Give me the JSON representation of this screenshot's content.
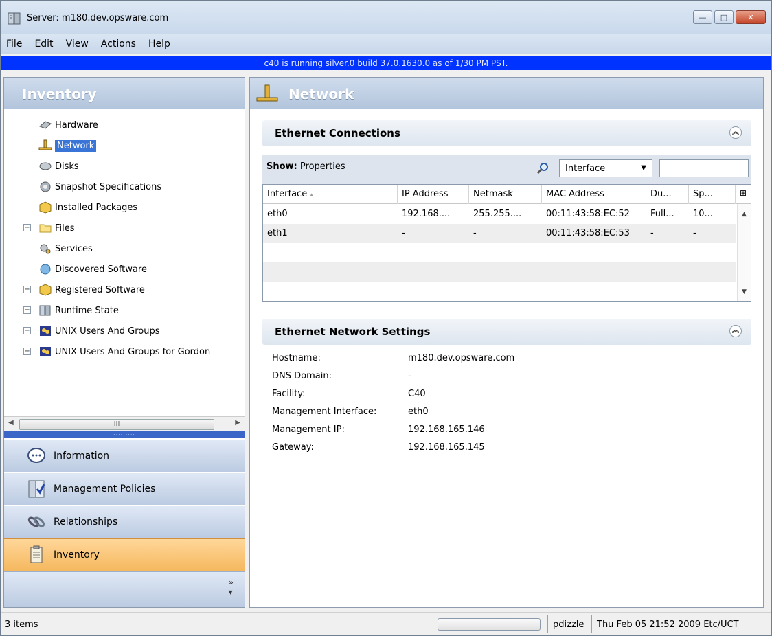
{
  "window": {
    "title": "Server: m180.dev.opsware.com",
    "minimize": "—",
    "maximize": "□",
    "close": "✕"
  },
  "menu": [
    "File",
    "Edit",
    "View",
    "Actions",
    "Help"
  ],
  "banner": "c40 is running silver.0 build 37.0.1630.0 as of 1/30 PM PST.",
  "left": {
    "header": "Inventory",
    "tree": [
      {
        "label": "Hardware",
        "icon": "hardware-icon"
      },
      {
        "label": "Network",
        "icon": "network-icon",
        "selected": true
      },
      {
        "label": "Disks",
        "icon": "disk-icon"
      },
      {
        "label": "Snapshot Specifications",
        "icon": "snapshot-icon"
      },
      {
        "label": "Installed Packages",
        "icon": "package-icon"
      },
      {
        "label": "Files",
        "icon": "folder-icon",
        "expandable": true
      },
      {
        "label": "Services",
        "icon": "services-icon"
      },
      {
        "label": "Discovered Software",
        "icon": "discovered-software-icon"
      },
      {
        "label": "Registered Software",
        "icon": "registered-software-icon",
        "expandable": true
      },
      {
        "label": "Runtime State",
        "icon": "server-icon",
        "expandable": true
      },
      {
        "label": "UNIX Users And Groups",
        "icon": "users-icon",
        "expandable": true
      },
      {
        "label": "UNIX Users And Groups for Gordon",
        "icon": "users-icon",
        "expandable": true
      }
    ],
    "scroll_thumb": "III",
    "nav": [
      {
        "label": "Information",
        "icon": "info-icon"
      },
      {
        "label": "Management Policies",
        "icon": "policy-icon"
      },
      {
        "label": "Relationships",
        "icon": "relationships-icon"
      },
      {
        "label": "Inventory",
        "icon": "inventory-icon",
        "active": true
      }
    ],
    "more": "»"
  },
  "right": {
    "header": "Network",
    "ethernet_connections": {
      "title": "Ethernet Connections",
      "show_label": "Show:",
      "show_value": "Properties",
      "filter_select": "Interface",
      "filter_value": "",
      "columns": [
        "Interface",
        "IP Address",
        "Netmask",
        "MAC Address",
        "Du...",
        "Sp..."
      ],
      "rows": [
        [
          "eth0",
          "192.168....",
          "255.255....",
          "00:11:43:58:EC:52",
          "Full...",
          "10..."
        ],
        [
          "eth1",
          "-",
          "-",
          "00:11:43:58:EC:53",
          "-",
          "-"
        ]
      ]
    },
    "network_settings": {
      "title": "Ethernet Network Settings",
      "fields": [
        {
          "label": "Hostname:",
          "value": "m180.dev.opsware.com"
        },
        {
          "label": "DNS Domain:",
          "value": "-"
        },
        {
          "label": "Facility:",
          "value": "C40"
        },
        {
          "label": "Management Interface:",
          "value": "eth0"
        },
        {
          "label": "Management IP:",
          "value": "192.168.165.146"
        },
        {
          "label": "Gateway:",
          "value": "192.168.165.145"
        }
      ]
    }
  },
  "status": {
    "items": "3 items",
    "user": "pdizzle",
    "time": "Thu Feb 05 21:52 2009 Etc/UCT"
  }
}
